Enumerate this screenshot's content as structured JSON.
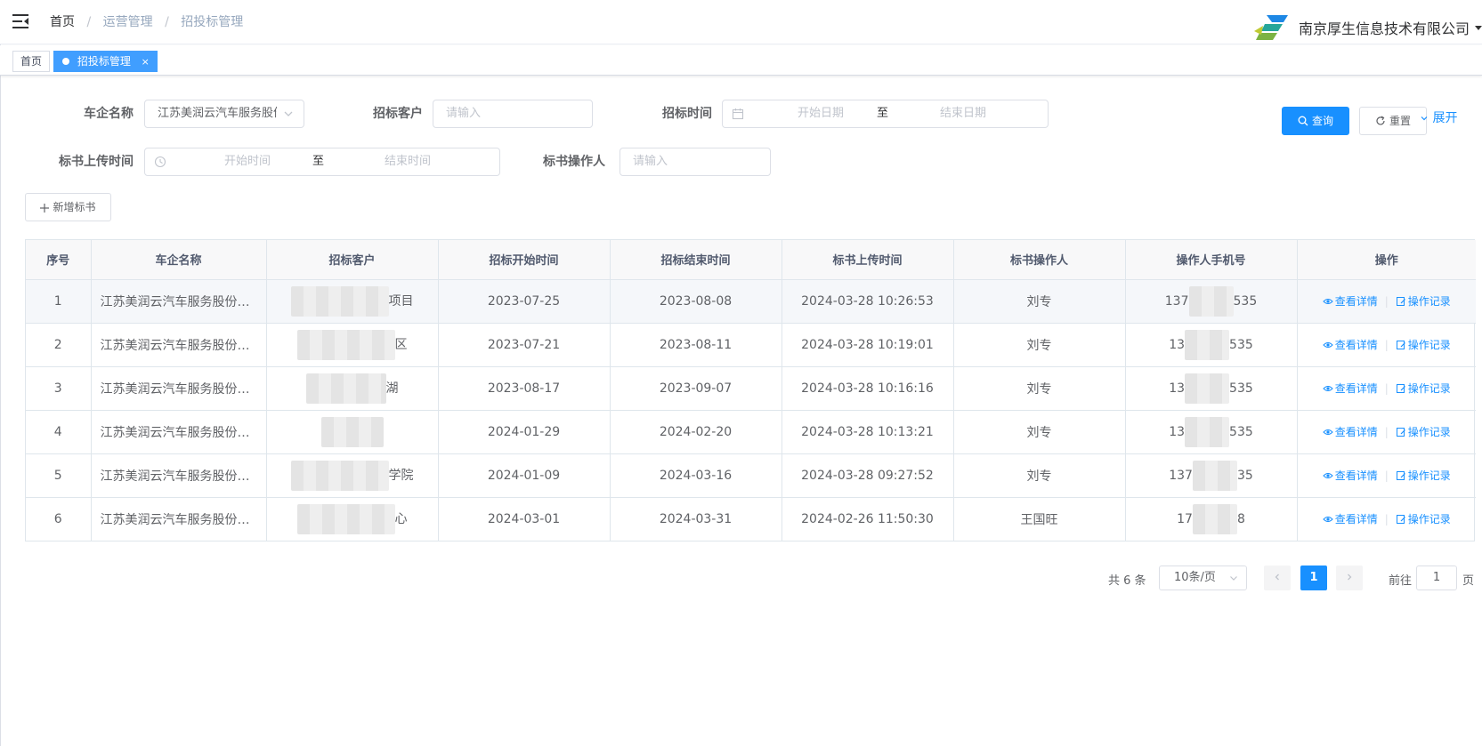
{
  "header": {
    "breadcrumb": [
      "首页",
      "运营管理",
      "招投标管理"
    ],
    "company_name": "南京厚生信息技术有限公司"
  },
  "tags": {
    "home": "首页",
    "active": "招投标管理",
    "close": "×"
  },
  "filters": {
    "company_label": "车企名称",
    "company_value": "江苏美润云汽车服务股份有限公司",
    "client_label": "招标客户",
    "client_placeholder": "请输入",
    "bid_time_label": "招标时间",
    "start_date_placeholder": "开始日期",
    "range_sep": "至",
    "end_date_placeholder": "结束日期",
    "upload_time_label": "标书上传时间",
    "start_time_placeholder": "开始时间",
    "end_time_placeholder": "结束时间",
    "operator_label": "标书操作人",
    "operator_placeholder": "请输入",
    "search_button": "查询",
    "reset_button": "重置",
    "expand_link": "展开"
  },
  "toolbar": {
    "add_button": "新增标书"
  },
  "table": {
    "columns": [
      "序号",
      "车企名称",
      "招标客户",
      "招标开始时间",
      "招标结束时间",
      "标书上传时间",
      "标书操作人",
      "操作人手机号",
      "操作"
    ],
    "rows": [
      {
        "index": "1",
        "company": "江苏美润云汽车服务股份有限公司",
        "client_suffix": "项目",
        "start": "2023-07-25",
        "end": "2023-08-08",
        "uploaded": "2024-03-28 10:26:53",
        "operator": "刘专",
        "phone_prefix": "137",
        "phone_suffix": "535"
      },
      {
        "index": "2",
        "company": "江苏美润云汽车服务股份有限公司",
        "client_suffix": "区",
        "start": "2023-07-21",
        "end": "2023-08-11",
        "uploaded": "2024-03-28 10:19:01",
        "operator": "刘专",
        "phone_prefix": "13",
        "phone_suffix": "535"
      },
      {
        "index": "3",
        "company": "江苏美润云汽车服务股份有限公司",
        "client_suffix": "湖",
        "start": "2023-08-17",
        "end": "2023-09-07",
        "uploaded": "2024-03-28 10:16:16",
        "operator": "刘专",
        "phone_prefix": "13",
        "phone_suffix": "535"
      },
      {
        "index": "4",
        "company": "江苏美润云汽车服务股份有限公司",
        "client_suffix": "",
        "start": "2024-01-29",
        "end": "2024-02-20",
        "uploaded": "2024-03-28 10:13:21",
        "operator": "刘专",
        "phone_prefix": "13",
        "phone_suffix": "535"
      },
      {
        "index": "5",
        "company": "江苏美润云汽车服务股份有限公司",
        "client_suffix": "学院",
        "start": "2024-01-09",
        "end": "2024-03-16",
        "uploaded": "2024-03-28 09:27:52",
        "operator": "刘专",
        "phone_prefix": "137",
        "phone_suffix": "35"
      },
      {
        "index": "6",
        "company": "江苏美润云汽车服务股份有限公司",
        "client_suffix": "心",
        "start": "2024-03-01",
        "end": "2024-03-31",
        "uploaded": "2024-02-26 11:50:30",
        "operator": "王国旺",
        "phone_prefix": "17",
        "phone_suffix": "8"
      }
    ],
    "view_label": "查看详情",
    "log_label": "操作记录"
  },
  "pagination": {
    "total": "共 6 条",
    "page_size": "10条/页",
    "current_page": "1",
    "goto_label": "前往",
    "goto_value": "1",
    "goto_suffix": "页"
  },
  "colors": {
    "primary": "#1890ff",
    "tag_active": "#409eff"
  }
}
